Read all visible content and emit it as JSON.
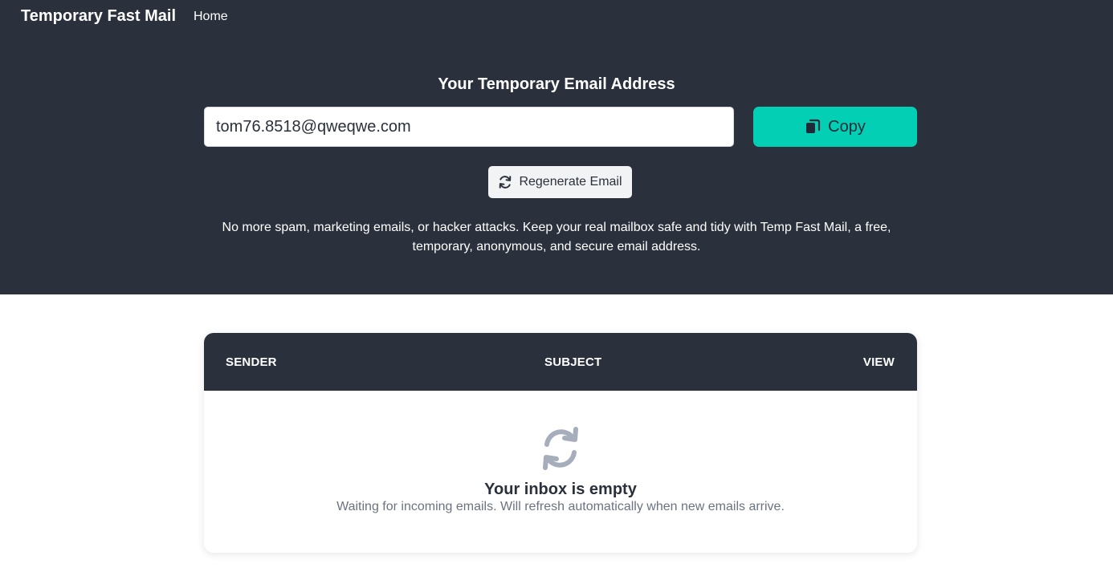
{
  "nav": {
    "brand": "Temporary Fast Mail",
    "links": [
      {
        "label": "Home"
      }
    ]
  },
  "hero": {
    "title": "Your Temporary Email Address",
    "email_value": "tom76.8518@qweqwe.com",
    "copy_label": "Copy",
    "regenerate_label": "Regenerate Email",
    "description": "No more spam, marketing emails, or hacker attacks. Keep your real mailbox safe and tidy with Temp Fast Mail, a free, temporary, anonymous, and secure email address."
  },
  "inbox": {
    "columns": [
      "SENDER",
      "SUBJECT",
      "VIEW"
    ],
    "empty_icon": "refresh-icon",
    "empty_title": "Your inbox is empty",
    "empty_description": "Waiting for incoming emails. Will refresh automatically when new emails arrive."
  },
  "colors": {
    "dark": "#2a303c",
    "accent": "#03cfb4",
    "muted": "#6b7280",
    "icon_gray": "#a6adbb"
  }
}
